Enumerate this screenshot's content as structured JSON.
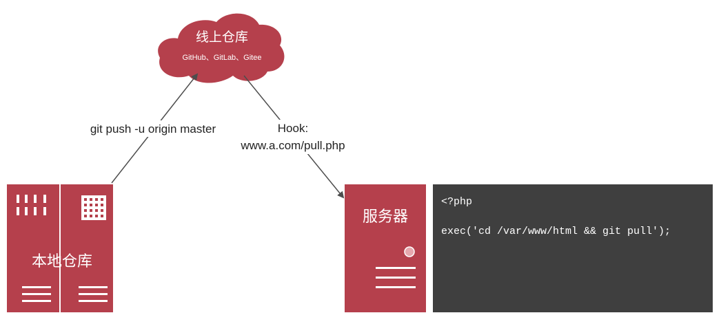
{
  "cloud": {
    "title": "线上仓库",
    "subtitle": "GitHub、GitLab、Gitee"
  },
  "arrows": {
    "push_label": "git push -u origin master",
    "hook_label_line1": "Hook:",
    "hook_label_line2": "www.a.com/pull.php"
  },
  "local": {
    "label": "本地仓库"
  },
  "server": {
    "label": "服务器"
  },
  "code": {
    "line1": "<?php",
    "line2": "exec('cd /var/www/html && git pull');"
  },
  "colors": {
    "box": "#b5404c",
    "code_bg": "#3f3f3f",
    "arrow": "#4d4d4d",
    "text": "#222222",
    "code_text": "#ffffff"
  }
}
